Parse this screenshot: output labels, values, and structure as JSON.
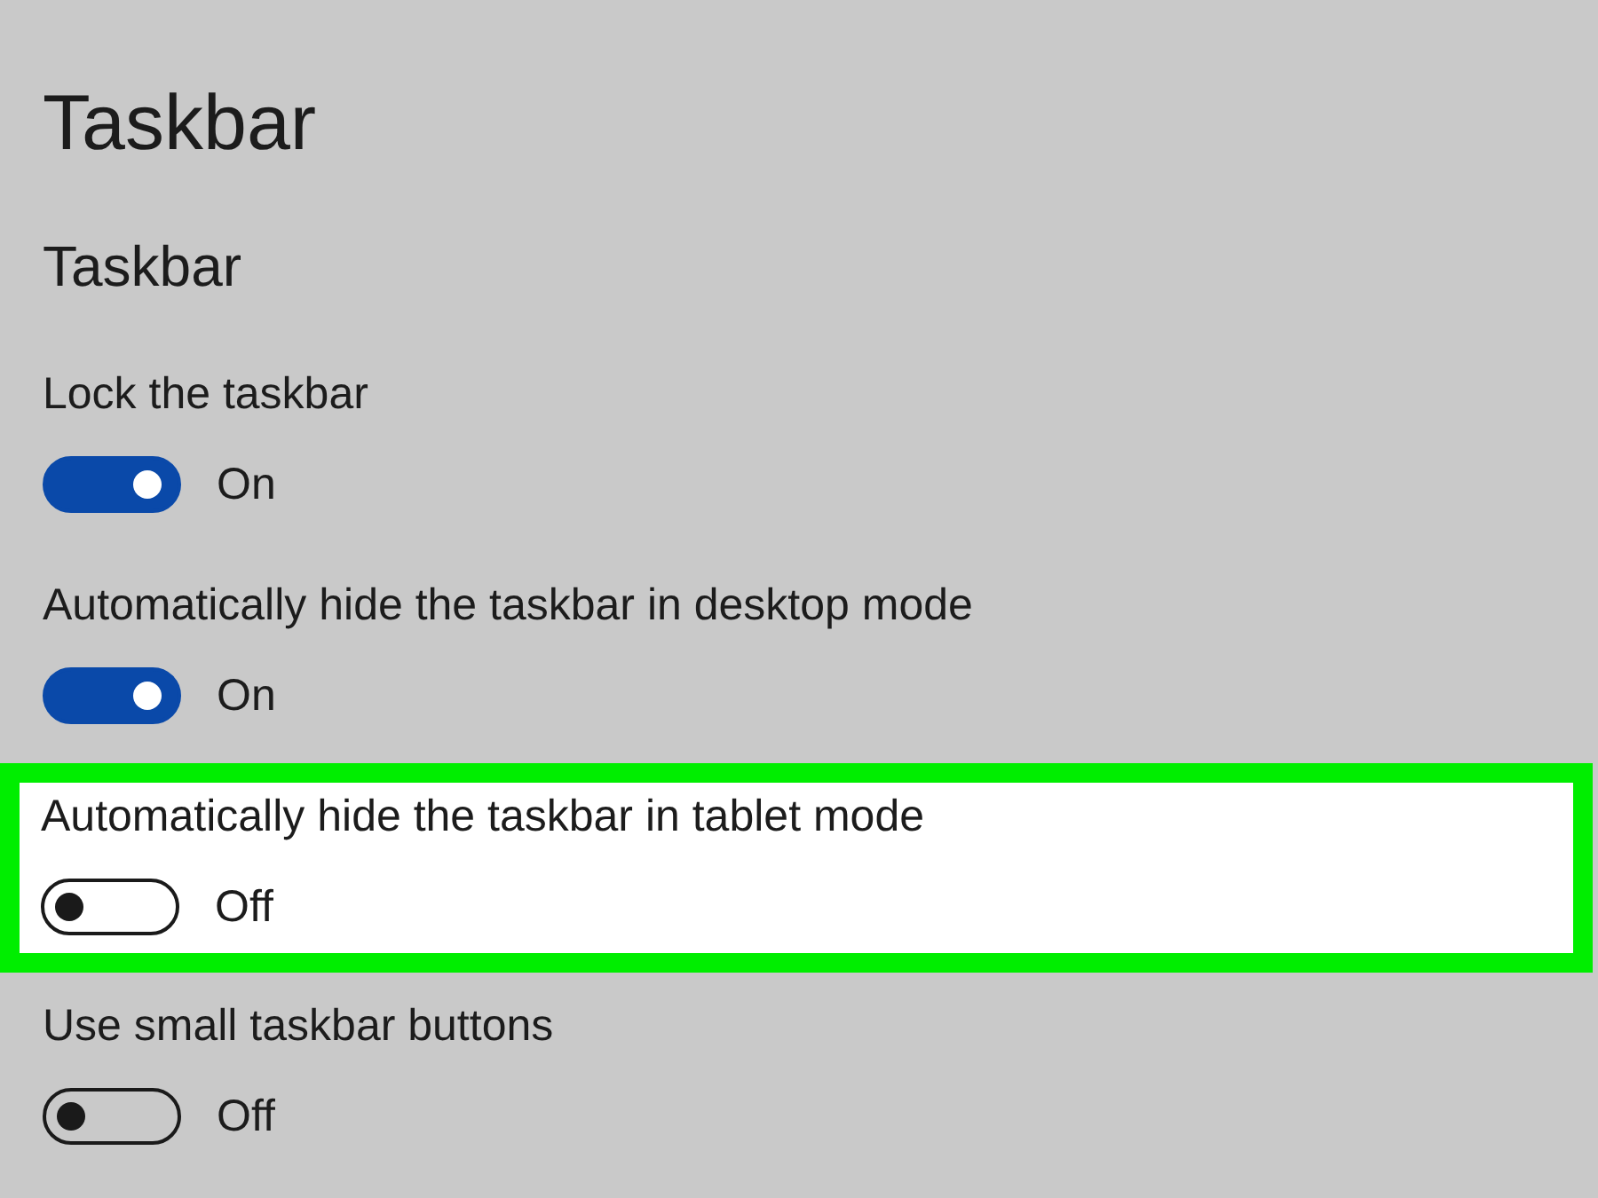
{
  "page": {
    "title": "Taskbar",
    "section_title": "Taskbar"
  },
  "settings": [
    {
      "label": "Lock the taskbar",
      "on": true,
      "state_label": "On",
      "highlighted": false
    },
    {
      "label": "Automatically hide the taskbar in desktop mode",
      "on": true,
      "state_label": "On",
      "highlighted": false
    },
    {
      "label": "Automatically hide the taskbar in tablet mode",
      "on": false,
      "state_label": "Off",
      "highlighted": true
    },
    {
      "label": "Use small taskbar buttons",
      "on": false,
      "state_label": "Off",
      "highlighted": false
    }
  ]
}
